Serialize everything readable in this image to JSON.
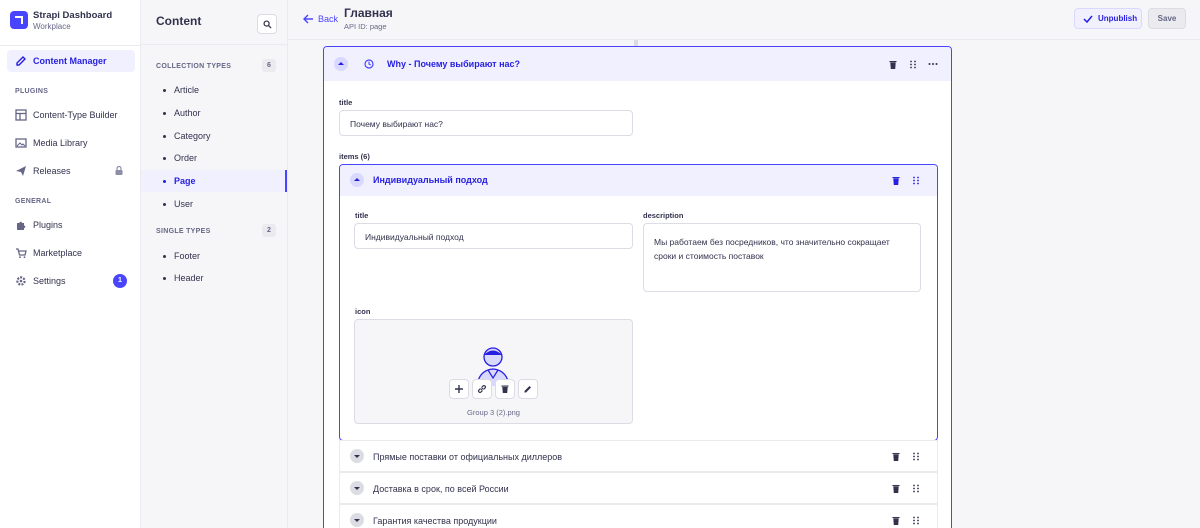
{
  "brand": {
    "title": "Strapi Dashboard",
    "subtitle": "Workplace",
    "accent": "#4945ff"
  },
  "nav": {
    "content_manager": "Content Manager",
    "plugins_section": "PLUGINS",
    "content_type_builder": "Content-Type Builder",
    "media_library": "Media Library",
    "releases": "Releases",
    "general_section": "GENERAL",
    "plugins": "Plugins",
    "marketplace": "Marketplace",
    "settings": "Settings",
    "settings_badge": "1"
  },
  "subnav": {
    "title": "Content",
    "collection_types": {
      "label": "COLLECTION TYPES",
      "count": "6",
      "items": [
        "Article",
        "Author",
        "Category",
        "Order",
        "Page",
        "User"
      ]
    },
    "single_types": {
      "label": "SINGLE TYPES",
      "count": "2",
      "items": [
        "Footer",
        "Header"
      ]
    },
    "active": "Page"
  },
  "header": {
    "back": "Back",
    "title": "Главная",
    "api_id": "API ID: page",
    "unpublish": "Unpublish",
    "save": "Save"
  },
  "component": {
    "title": "Why - Почему выбирают нас?",
    "title_field": {
      "label": "title",
      "value": "Почему выбирают нас?"
    },
    "items_label": "items (6)",
    "expanded_item": {
      "title": "Индивидуальный подход",
      "title_field": {
        "label": "title",
        "value": "Индивидуальный подход"
      },
      "description_field": {
        "label": "description",
        "value": "Мы работаем без посредников, что значительно сокращает сроки и стоимость поставок"
      },
      "icon_field": {
        "label": "icon",
        "file_name": "Group 3 (2).png"
      }
    },
    "collapsed_items": [
      "Прямые поставки от официальных диллеров",
      "Доставка в срок, по всей России",
      "Гарантия качества продукции"
    ]
  }
}
